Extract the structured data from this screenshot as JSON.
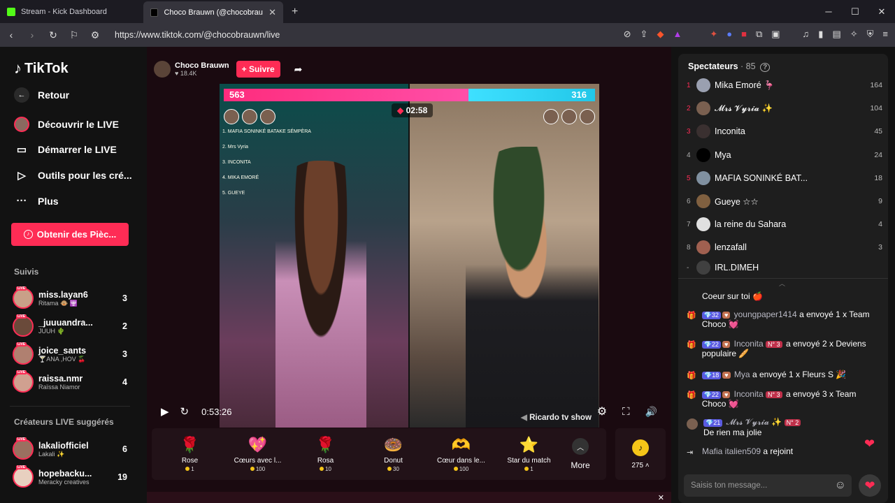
{
  "browser": {
    "tabs": [
      {
        "title": "Stream - Kick Dashboard",
        "icon_color": "#53fc18"
      },
      {
        "title": "Choco Brauwn (@chocobrauwn)"
      }
    ],
    "url": "https://www.tiktok.com/@chocobrauwn/live"
  },
  "sidebar": {
    "logo": "TikTok",
    "nav": [
      {
        "label": "Retour",
        "icon": "arrow-left-icon"
      },
      {
        "label": "Découvrir le LIVE",
        "icon": "live-avatar-icon"
      },
      {
        "label": "Démarrer le LIVE",
        "icon": "video-camera-icon"
      },
      {
        "label": "Outils pour les cré...",
        "icon": "play-square-icon"
      },
      {
        "label": "Plus",
        "icon": "more-dots-icon"
      }
    ],
    "coins_button": "Obtenir des Pièc...",
    "suivis_title": "Suivis",
    "following": [
      {
        "name": "miss.layan6",
        "sub": "Ritama 🐵 🕎",
        "count": "3"
      },
      {
        "name": "_juuuandra...",
        "sub": "JUUH 🌵",
        "count": "2"
      },
      {
        "name": "joice_sants",
        "sub": "🍸ANA ,HOV 🍒",
        "count": "3"
      },
      {
        "name": "raissa.nmr",
        "sub": "Raïssa Niamor",
        "count": "4"
      }
    ],
    "suggested_title": "Créateurs LIVE suggérés",
    "suggested": [
      {
        "name": "lakaliofficiel",
        "sub": "Lakali ✨",
        "count": "6"
      },
      {
        "name": "hopebacku...",
        "sub": "Meracky creatives",
        "count": "19"
      }
    ]
  },
  "stream": {
    "streamer_name": "Choco Brauwn",
    "followers": "18.4K",
    "follow_label": "+ Suivre",
    "score_left": "563",
    "score_right": "316",
    "timer": "02:58",
    "elapsed": "0:53:26",
    "caption": "Ricardo tv show",
    "left_avatar_counts": [
      "3",
      "2",
      "1"
    ],
    "right_avatar_counts": [
      "1",
      "2",
      "3"
    ],
    "mini_ranking": [
      "1. MAFIA SONINKÉ BATAKE SÉMPÈRA",
      "2. Mrs Vyria",
      "3. INCONITA",
      "4. MIKA EMORÉ",
      "5. GUEYE"
    ]
  },
  "gifts": [
    {
      "name": "Rose",
      "price": "1",
      "icon": "🌹"
    },
    {
      "name": "Cœurs avec l...",
      "price": "100",
      "icon": "💖"
    },
    {
      "name": "Rosa",
      "price": "10",
      "icon": "🌹"
    },
    {
      "name": "Donut",
      "price": "30",
      "icon": "🍩"
    },
    {
      "name": "Cœur dans le...",
      "price": "100",
      "icon": "🫶"
    },
    {
      "name": "Star du match",
      "price": "1",
      "icon": "⭐"
    }
  ],
  "more_label": "More",
  "coin_balance": "275",
  "viewers_panel": {
    "title": "Spectateurs",
    "count": "· 85",
    "viewers": [
      {
        "rank": "1",
        "name": "Mika Emoré 🦩",
        "score": "164"
      },
      {
        "rank": "2",
        "name": "𝓜𝓻𝓼 𝓥𝔂𝓻𝓲𝓪 ✨",
        "score": "104"
      },
      {
        "rank": "3",
        "name": "Inconita",
        "score": "45"
      },
      {
        "rank": "4",
        "name": "Mya",
        "score": "24"
      },
      {
        "rank": "5",
        "name": "MAFIA SONINKÉ BAT...",
        "score": "18"
      },
      {
        "rank": "6",
        "name": "Gueye ☆☆",
        "score": "9"
      },
      {
        "rank": "7",
        "name": "la reine du Sahara",
        "score": "4"
      },
      {
        "rank": "8",
        "name": "lenzafall",
        "score": "3"
      },
      {
        "rank": "-",
        "name": "IRL.DIMEH",
        "score": ""
      }
    ]
  },
  "chat": [
    {
      "text": "Coeur sur toi 🍎"
    },
    {
      "lvl": "32",
      "user": "youngpaper1414",
      "msg": "a envoyé 1 x Team Choco 💓"
    },
    {
      "lvl": "22",
      "user": "Inconita",
      "badge": "N° 3",
      "msg": "a envoyé 2 x Deviens populaire 🥖"
    },
    {
      "lvl": "18",
      "user": "Mya",
      "msg": "a envoyé 1 x Fleurs S 🎉"
    },
    {
      "lvl": "22",
      "user": "Inconita",
      "badge": "N° 3",
      "msg": "a envoyé 3 x Team Choco 💓"
    },
    {
      "lvl": "21",
      "user": "𝓜𝓻𝓼 𝓥𝔂𝓻𝓲𝓪 ✨",
      "badge": "N° 2",
      "msg": "De rien ma jolie"
    },
    {
      "user": "Mafia italien509",
      "msg": "a rejoint"
    }
  ],
  "chat_placeholder": "Saisis ton message..."
}
